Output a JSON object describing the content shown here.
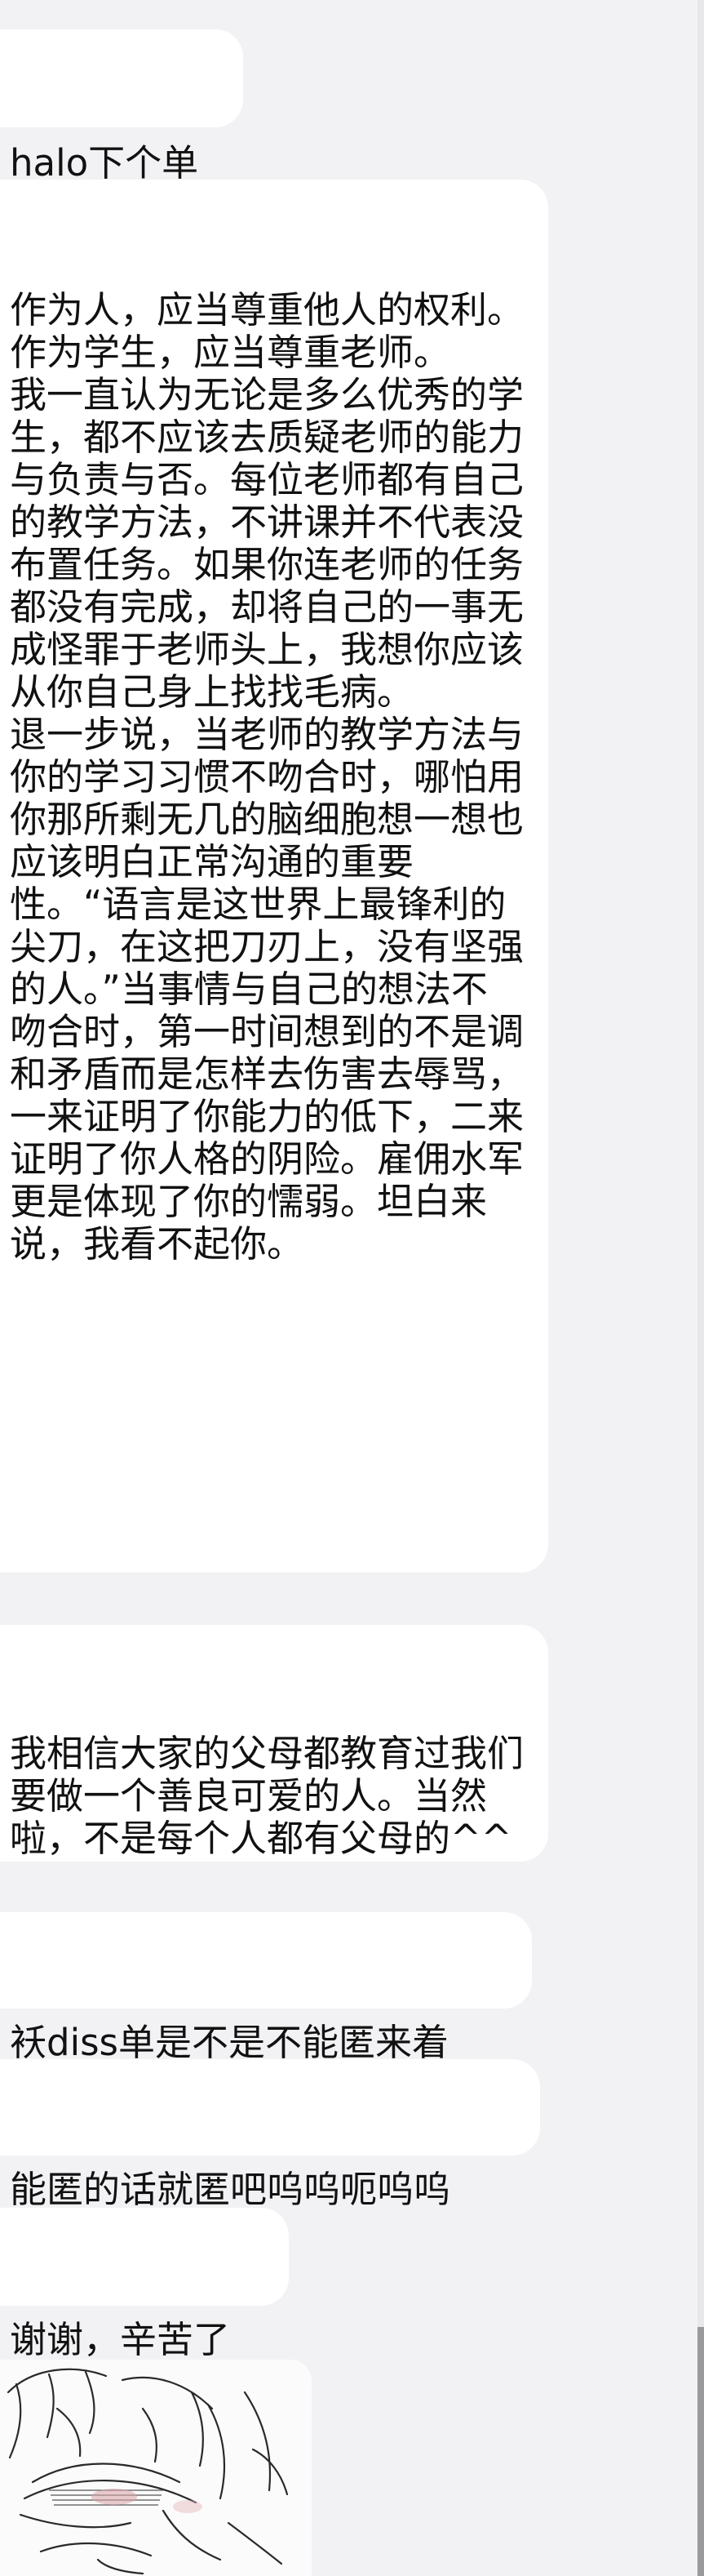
{
  "messages": [
    {
      "text": "halo下个单"
    },
    {
      "text": "作为人，应当尊重他人的权利。作为学生，应当尊重老师。\n我一直认为无论是多么优秀的学生，都不应该去质疑老师的能力与负责与否。每位老师都有自己的教学方法，不讲课并不代表没布置任务。如果你连老师的任务都没有完成，却将自己的一事无成怪罪于老师头上，我想你应该从你自己身上找找毛病。\n退一步说，当老师的教学方法与你的学习习惯不吻合时，哪怕用你那所剩无几的脑细胞想一想也应该明白正常沟通的重要性。“语言是这世界上最锋利的尖刀，在这把刀刃上，没有坚强的人。”当事情与自己的想法不吻合时，第一时间想到的不是调和矛盾而是怎样去伤害去辱骂，一来证明了你能力的低下，二来证明了你人格的阴险。雇佣水军更是体现了你的懦弱。坦白来说，我看不起你。"
    },
    {
      "text": "我相信大家的父母都教育过我们要做一个善良可爱的人。当然啦，不是每个人都有父母的^^"
    },
    {
      "text": "袄diss单是不是不能匿来着"
    },
    {
      "text": "能匿的话就匿吧呜呜呃呜呜"
    },
    {
      "text": "谢谢，辛苦了"
    }
  ],
  "image_message": {
    "icon": "sketch-image"
  },
  "colors": {
    "background": "#f2f2f4",
    "bubble": "#ffffff",
    "text": "#111111",
    "scrollbar_thumb": "#9a9a9e"
  }
}
